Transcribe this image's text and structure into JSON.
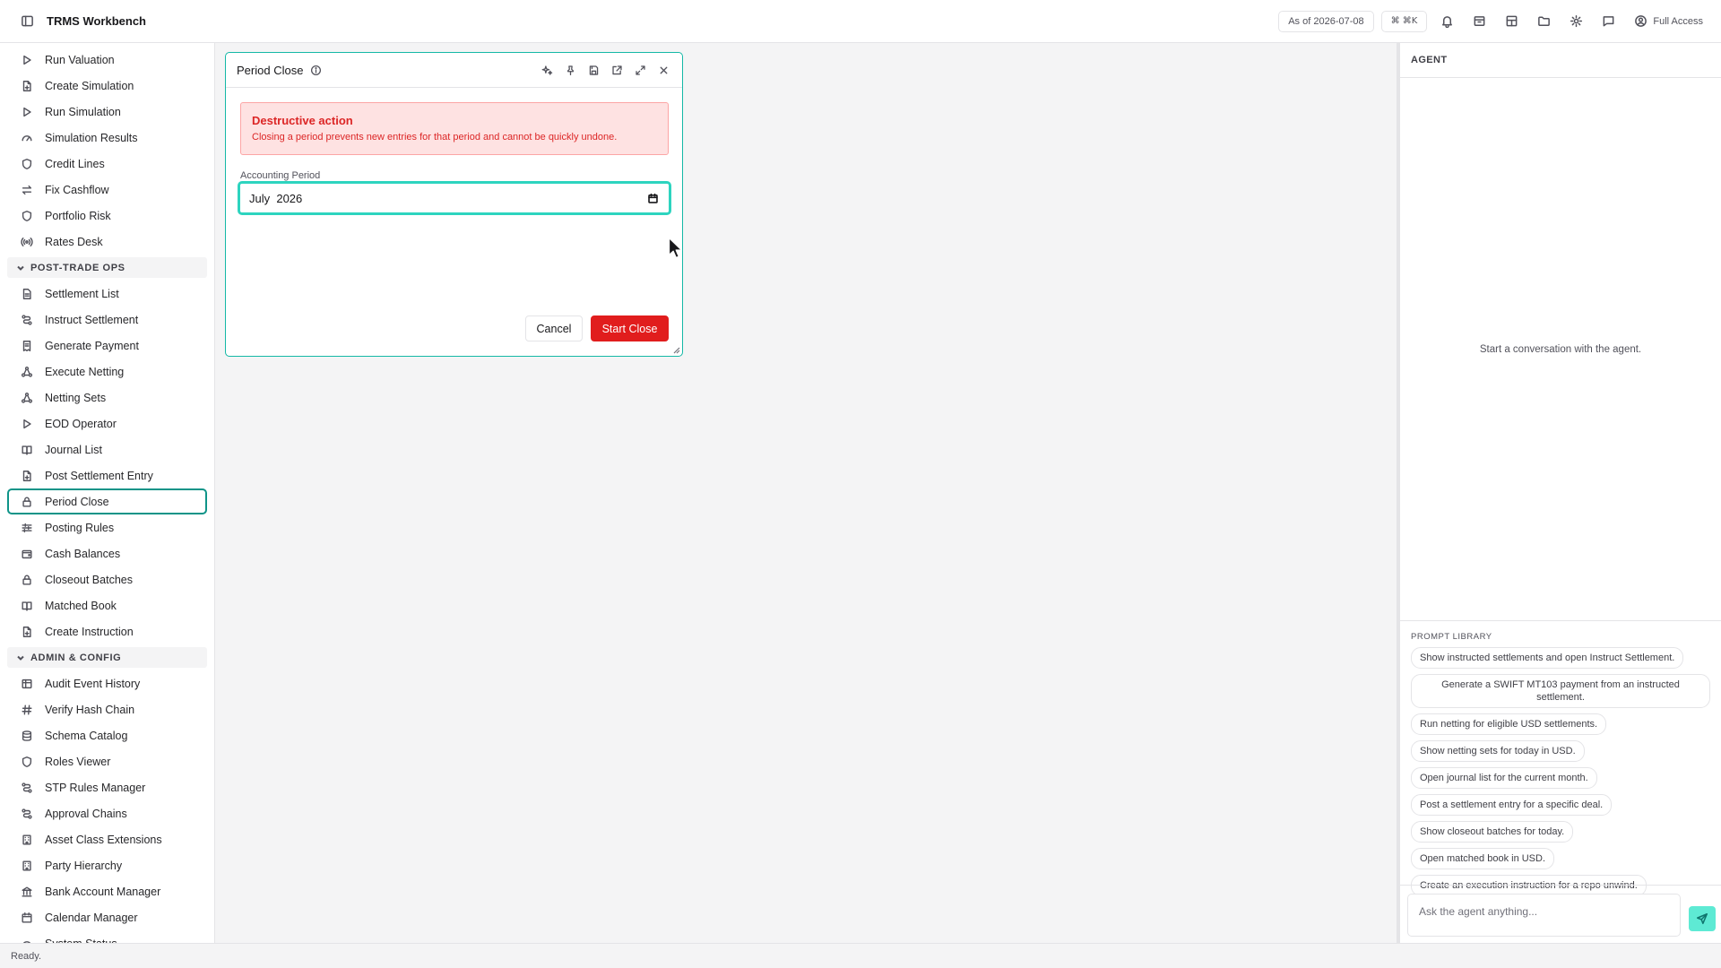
{
  "app": {
    "title": "TRMS Workbench",
    "as_of": "As of 2026-07-08",
    "shortcut": "⌘ ⌘K",
    "access": "Full Access",
    "accent": "#0f9488",
    "danger": "#e11d1d"
  },
  "sidebar": {
    "groups": [
      {
        "section": null,
        "items": [
          {
            "label": "Run Valuation",
            "icon": "play-icon"
          },
          {
            "label": "Create Simulation",
            "icon": "file-plus-icon"
          },
          {
            "label": "Run Simulation",
            "icon": "play-icon"
          },
          {
            "label": "Simulation Results",
            "icon": "gauge-icon"
          },
          {
            "label": "Credit Lines",
            "icon": "shield-icon"
          },
          {
            "label": "Fix Cashflow",
            "icon": "arrows-swap-icon"
          },
          {
            "label": "Portfolio Risk",
            "icon": "shield-icon"
          },
          {
            "label": "Rates Desk",
            "icon": "broadcast-icon"
          }
        ]
      },
      {
        "section": "POST-TRADE OPS",
        "items": [
          {
            "label": "Settlement List",
            "icon": "document-icon"
          },
          {
            "label": "Instruct Settlement",
            "icon": "route-icon"
          },
          {
            "label": "Generate Payment",
            "icon": "receipt-icon"
          },
          {
            "label": "Execute Netting",
            "icon": "network-icon"
          },
          {
            "label": "Netting Sets",
            "icon": "network-icon"
          },
          {
            "label": "EOD Operator",
            "icon": "play-icon"
          },
          {
            "label": "Journal List",
            "icon": "book-icon"
          },
          {
            "label": "Post Settlement Entry",
            "icon": "file-plus-icon"
          },
          {
            "label": "Period Close",
            "icon": "lock-icon",
            "active": true
          },
          {
            "label": "Posting Rules",
            "icon": "sliders-icon"
          },
          {
            "label": "Cash Balances",
            "icon": "wallet-icon"
          },
          {
            "label": "Closeout Batches",
            "icon": "lock-icon"
          },
          {
            "label": "Matched Book",
            "icon": "book-icon"
          },
          {
            "label": "Create Instruction",
            "icon": "file-plus-icon"
          }
        ]
      },
      {
        "section": "ADMIN & CONFIG",
        "items": [
          {
            "label": "Audit Event History",
            "icon": "table-icon"
          },
          {
            "label": "Verify Hash Chain",
            "icon": "hash-icon"
          },
          {
            "label": "Schema Catalog",
            "icon": "database-icon"
          },
          {
            "label": "Roles Viewer",
            "icon": "shield-icon"
          },
          {
            "label": "STP Rules Manager",
            "icon": "route-icon"
          },
          {
            "label": "Approval Chains",
            "icon": "route-icon"
          },
          {
            "label": "Asset Class Extensions",
            "icon": "building-icon"
          },
          {
            "label": "Party Hierarchy",
            "icon": "building-icon"
          },
          {
            "label": "Bank Account Manager",
            "icon": "bank-icon"
          },
          {
            "label": "Calendar Manager",
            "icon": "calendar-icon"
          },
          {
            "label": "System Status",
            "icon": "gauge-icon"
          }
        ]
      }
    ]
  },
  "panel": {
    "title": "Period Close",
    "alert_title": "Destructive action",
    "alert_text": "Closing a period prevents new entries for that period and cannot be quickly undone.",
    "field_label": "Accounting Period",
    "field_value": "July  2026",
    "cancel_label": "Cancel",
    "start_label": "Start Close"
  },
  "agent": {
    "header": "AGENT",
    "empty": "Start a conversation with the agent.",
    "library_title": "PROMPT LIBRARY",
    "prompts": [
      "Show instructed settlements and open Instruct Settlement.",
      "Generate a SWIFT MT103 payment from an instructed settlement.",
      "Run netting for eligible USD settlements.",
      "Show netting sets for today in USD.",
      "Open journal list for the current month.",
      "Post a settlement entry for a specific deal.",
      "Show closeout batches for today.",
      "Open matched book in USD.",
      "Create an execution instruction for a repo unwind."
    ],
    "input_placeholder": "Ask the agent anything..."
  },
  "status": {
    "text": "Ready."
  }
}
